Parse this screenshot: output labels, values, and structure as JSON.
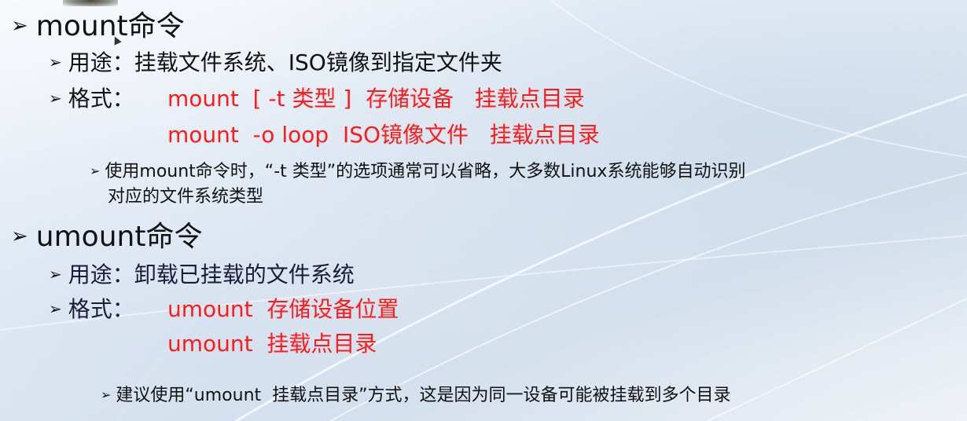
{
  "mount": {
    "heading": "mount命令",
    "usage": "用途：挂载文件系统、ISO镜像到指定文件夹",
    "format_label": "格式：",
    "format1": "mount  [ -t 类型 ]  存储设备   挂载点目录",
    "format2": "mount  -o loop  ISO镜像文件   挂载点目录",
    "note_line1": "使用mount命令时，“-t 类型”的选项通常可以省略，大多数Linux系统能够自动识别",
    "note_line2": "对应的文件系统类型"
  },
  "umount": {
    "heading": "umount命令",
    "usage": "用途：卸载已挂载的文件系统",
    "format_label": "格式：",
    "format1": "umount  存储设备位置",
    "format2": "umount  挂载点目录",
    "note": "建议使用“umount  挂载点目录”方式，这是因为同一设备可能被挂载到多个目录"
  },
  "icons": {
    "bullet": "arrow-bullet-icon"
  },
  "colors": {
    "red": "#ff1a1a",
    "text": "#111111"
  }
}
